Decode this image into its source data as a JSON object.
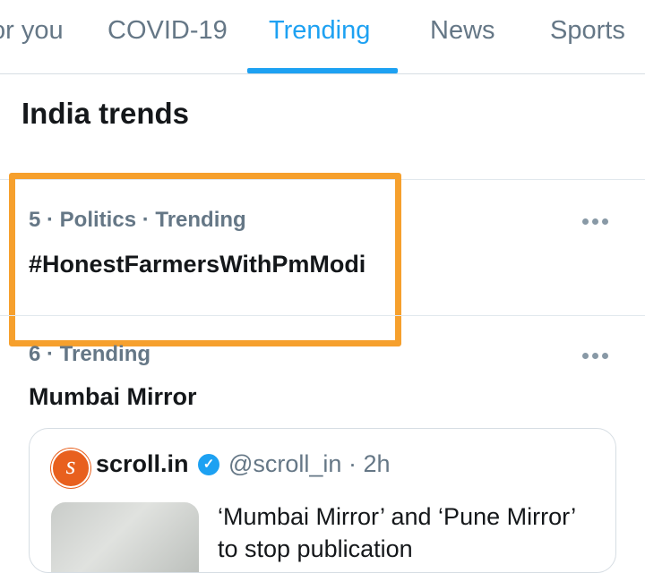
{
  "tabs": [
    {
      "label": "or you"
    },
    {
      "label": "COVID-19"
    },
    {
      "label": "Trending"
    },
    {
      "label": "News"
    },
    {
      "label": "Sports"
    }
  ],
  "active_tab": "Trending",
  "section": {
    "title": "India trends"
  },
  "trends": [
    {
      "meta": "5 · Politics · Trending",
      "name": "#HonestFarmersWithPmModi",
      "highlighted": true
    },
    {
      "meta": "6 · Trending",
      "name": "Mumbai Mirror",
      "highlighted": false
    }
  ],
  "tweet_card": {
    "account_name": "scroll.in",
    "handle_time": "@scroll_in · 2h",
    "avatar_letter": "s",
    "text": "‘Mumbai Mirror’ and ‘Pune Mirror’ to stop publication"
  },
  "colors": {
    "accent": "#1da1f2",
    "highlight_border": "#f6a02d",
    "secondary_text": "#657786"
  },
  "icons": [
    "more-options-icon",
    "verified-badge-icon"
  ]
}
